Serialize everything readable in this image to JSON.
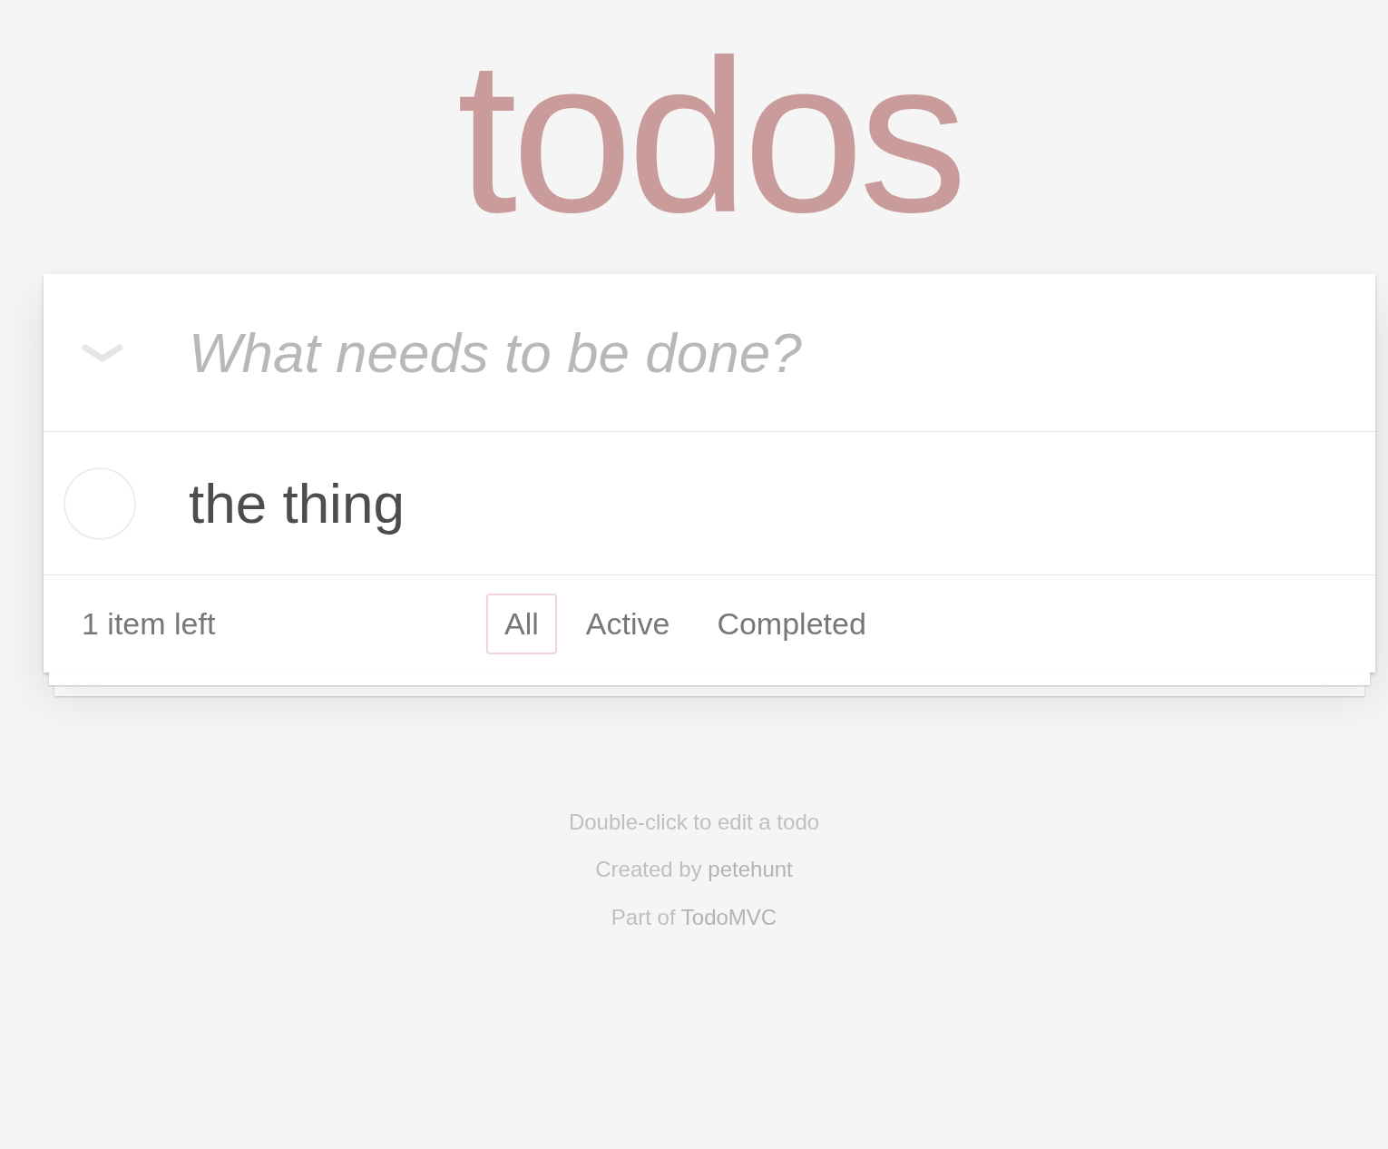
{
  "title": "todos",
  "new_todo": {
    "placeholder": "What needs to be done?"
  },
  "todos": [
    {
      "text": "the thing",
      "completed": false
    }
  ],
  "footer": {
    "count": "1 item left",
    "filters": [
      {
        "label": "All",
        "selected": true
      },
      {
        "label": "Active",
        "selected": false
      },
      {
        "label": "Completed",
        "selected": false
      }
    ]
  },
  "info": [
    {
      "text": "Double-click to edit a todo"
    },
    {
      "text": "Created by",
      "link": "petehunt"
    },
    {
      "text": "Part of",
      "link": "TodoMVC"
    }
  ]
}
